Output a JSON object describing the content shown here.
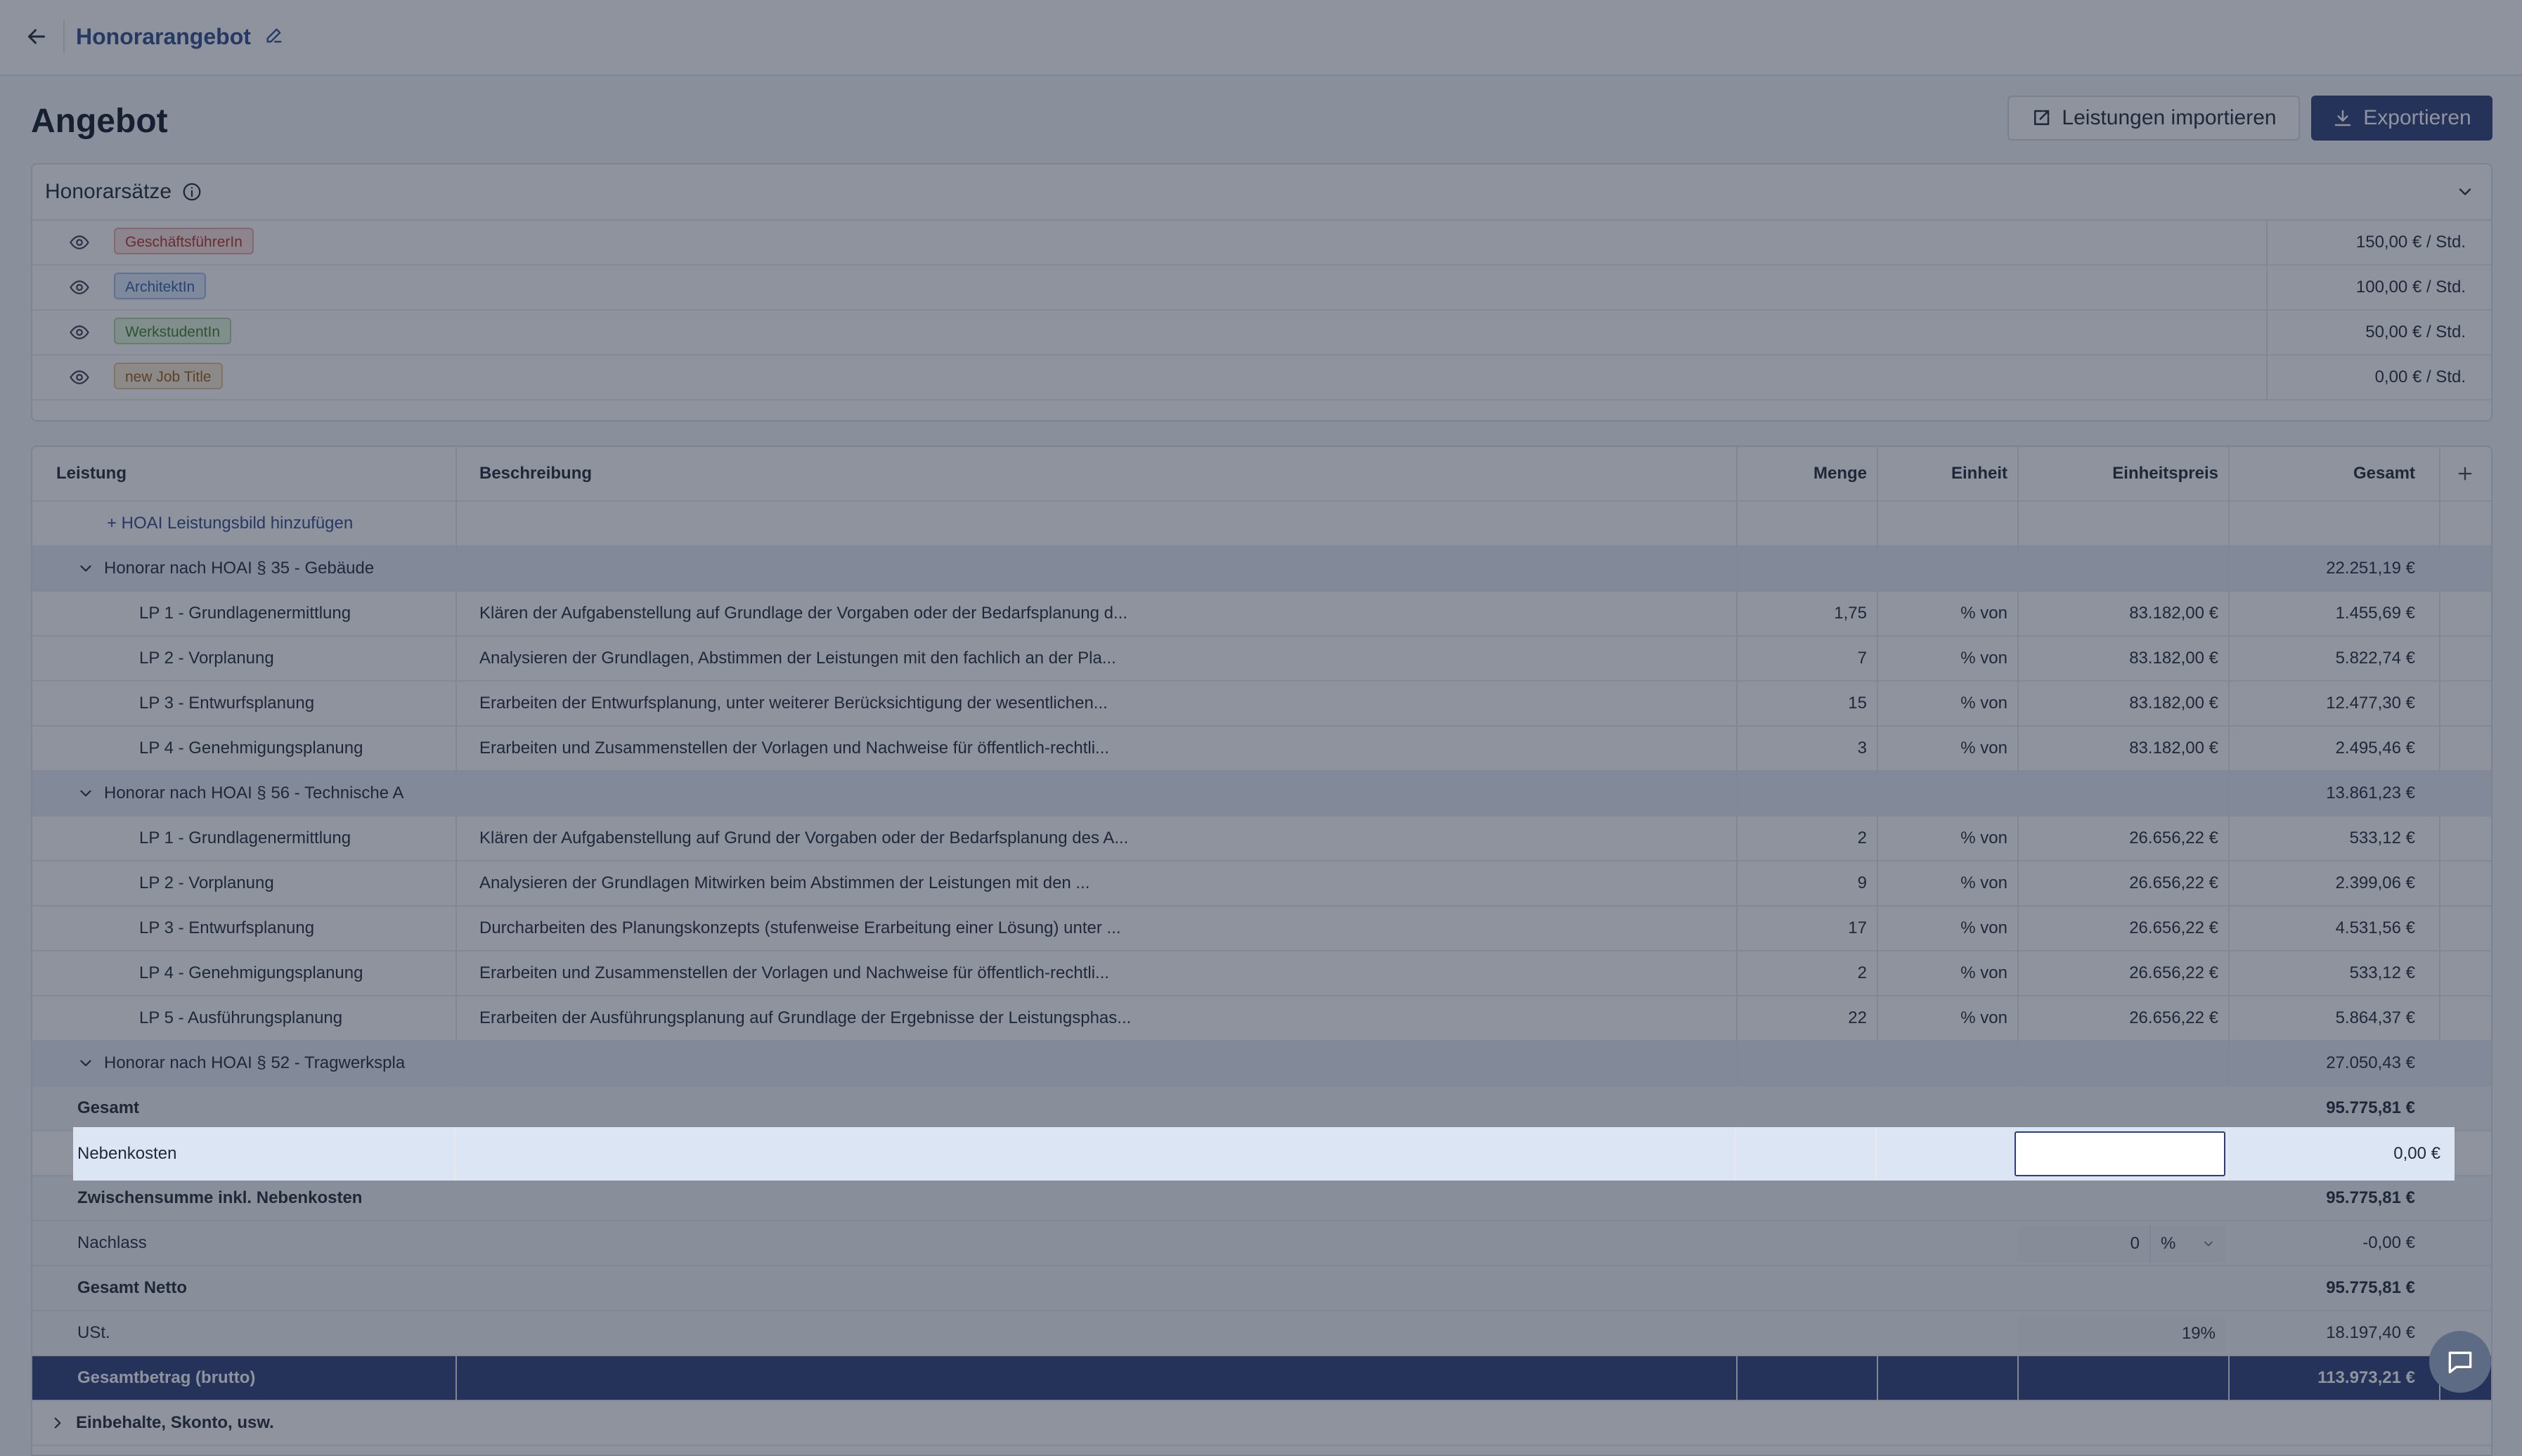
{
  "topbar": {
    "title": "Honorarangebot"
  },
  "page": {
    "title": "Angebot",
    "import_label": "Leistungen importieren",
    "export_label": "Exportieren"
  },
  "rates": {
    "title": "Honorarsätze",
    "items": [
      {
        "label": "GeschäftsführerIn",
        "value": "150,00 € / Std.",
        "bg": "#fde2e1",
        "border": "#e9a9a6",
        "color": "#b4312b"
      },
      {
        "label": "ArchitektIn",
        "value": "100,00 € / Std.",
        "bg": "#dfeafd",
        "border": "#9fbbe9",
        "color": "#2f5fb0"
      },
      {
        "label": "WerkstudentIn",
        "value": "50,00 € / Std.",
        "bg": "#e3f4dc",
        "border": "#a9d49a",
        "color": "#3f7f2c"
      },
      {
        "label": "new Job Title",
        "value": "0,00 € / Std.",
        "bg": "#fbecd5",
        "border": "#e6c08a",
        "color": "#9a5b12"
      }
    ]
  },
  "table": {
    "headers": {
      "leistung": "Leistung",
      "beschreibung": "Beschreibung",
      "menge": "Menge",
      "einheit": "Einheit",
      "einheitspreis": "Einheitspreis",
      "gesamt": "Gesamt"
    },
    "add_link": "+ HOAI Leistungsbild hinzufügen",
    "groups": [
      {
        "title": "Honorar nach HOAI § 35 - Gebäude",
        "total": "22.251,19 €",
        "rows": [
          {
            "name": "LP 1 - Grundlagenermittlung",
            "desc": "Klären der Aufgabenstellung auf Grundlage der Vorgaben oder der Bedarfsplanung d...",
            "menge": "1,75",
            "einheit": "% von",
            "preis": "83.182,00 €",
            "gesamt": "1.455,69 €"
          },
          {
            "name": "LP 2 - Vorplanung",
            "desc": "Analysieren der Grundlagen, Abstimmen der Leistungen mit den fachlich an der Pla...",
            "menge": "7",
            "einheit": "% von",
            "preis": "83.182,00 €",
            "gesamt": "5.822,74 €"
          },
          {
            "name": "LP 3 - Entwurfsplanung",
            "desc": "Erarbeiten der Entwurfsplanung, unter weiterer Berücksichtigung der wesentlichen...",
            "menge": "15",
            "einheit": "% von",
            "preis": "83.182,00 €",
            "gesamt": "12.477,30 €"
          },
          {
            "name": "LP 4 - Genehmigungsplanung",
            "desc": "Erarbeiten und Zusammenstellen der Vorlagen und Nachweise für öffentlich-rechtli...",
            "menge": "3",
            "einheit": "% von",
            "preis": "83.182,00 €",
            "gesamt": "2.495,46 €"
          }
        ]
      },
      {
        "title": "Honorar nach HOAI § 56 - Technische A",
        "total": "13.861,23 €",
        "rows": [
          {
            "name": "LP 1 - Grundlagenermittlung",
            "desc": "Klären der Aufgabenstellung auf Grund der Vorgaben oder der Bedarfsplanung des A...",
            "menge": "2",
            "einheit": "% von",
            "preis": "26.656,22 €",
            "gesamt": "533,12 €"
          },
          {
            "name": "LP 2 - Vorplanung",
            "desc": "Analysieren der Grundlagen Mitwirken beim Abstimmen der Leistungen mit den ...",
            "menge": "9",
            "einheit": "% von",
            "preis": "26.656,22 €",
            "gesamt": "2.399,06 €"
          },
          {
            "name": "LP 3 - Entwurfsplanung",
            "desc": "Durcharbeiten des Planungskonzepts (stufenweise Erarbeitung einer Lösung) unter ...",
            "menge": "17",
            "einheit": "% von",
            "preis": "26.656,22 €",
            "gesamt": "4.531,56 €"
          },
          {
            "name": "LP 4 - Genehmigungsplanung",
            "desc": "Erarbeiten und Zusammenstellen der Vorlagen und Nachweise für öffentlich-rechtli...",
            "menge": "2",
            "einheit": "% von",
            "preis": "26.656,22 €",
            "gesamt": "533,12 €"
          },
          {
            "name": "LP 5 - Ausführungsplanung",
            "desc": "Erarbeiten der Ausführungsplanung auf Grundlage der Ergebnisse der Leistungsphas...",
            "menge": "22",
            "einheit": "% von",
            "preis": "26.656,22 €",
            "gesamt": "5.864,37 €"
          }
        ]
      },
      {
        "title": "Honorar nach HOAI § 52 - Tragwerkspla",
        "total": "27.050,43 €",
        "rows": []
      }
    ],
    "summary": {
      "gesamt_label": "Gesamt",
      "gesamt_value": "95.775,81 €",
      "nebenkosten_label": "Nebenkosten",
      "nebenkosten_input": "",
      "nebenkosten_value": "0,00 €",
      "zwischen_label": "Zwischensumme inkl. Nebenkosten",
      "zwischen_value": "95.775,81 €",
      "nachlass_label": "Nachlass",
      "nachlass_input": "0",
      "nachlass_unit": "%",
      "nachlass_value": "-0,00 €",
      "netto_label": "Gesamt Netto",
      "netto_value": "95.775,81 €",
      "ust_label": "USt.",
      "ust_input": "19%",
      "ust_value": "18.197,40 €",
      "brutto_label": "Gesamtbetrag (brutto)",
      "brutto_value": "113.973,21 €",
      "einbehalte_label": "Einbehalte, Skonto, usw."
    }
  }
}
